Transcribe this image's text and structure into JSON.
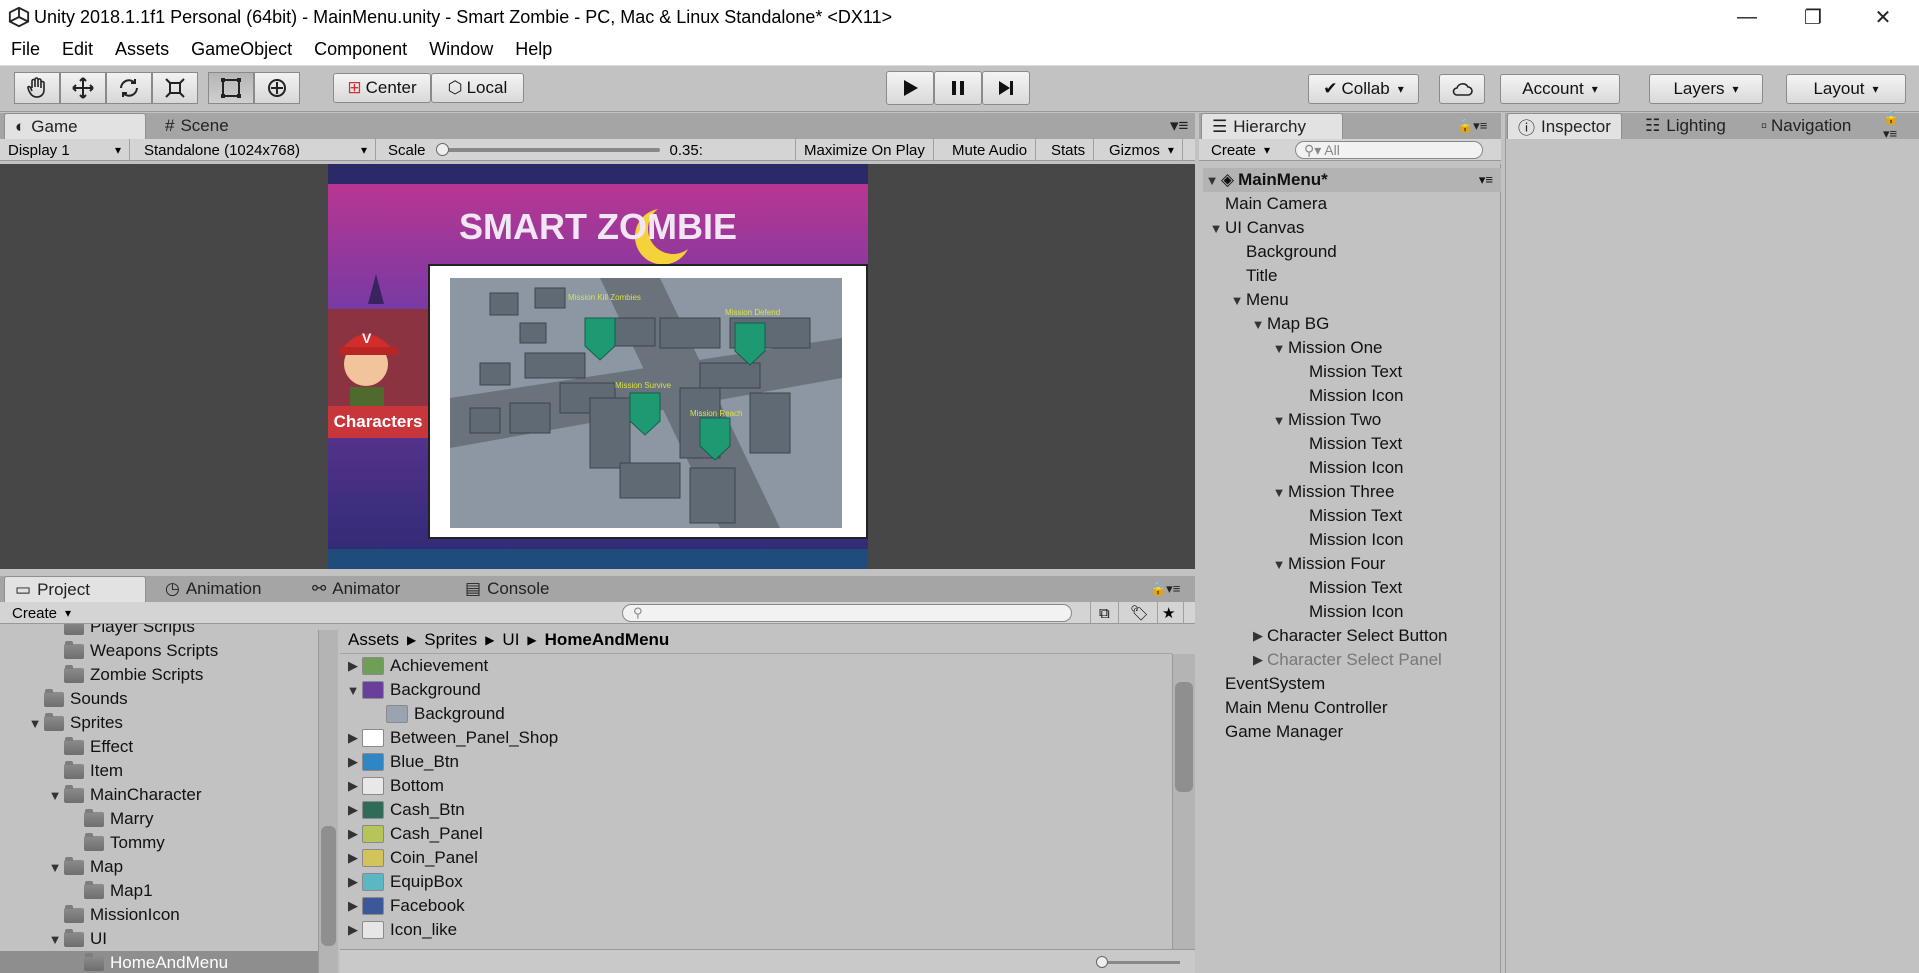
{
  "window": {
    "title": "Unity 2018.1.1f1 Personal (64bit) - MainMenu.unity - Smart Zombie - PC, Mac & Linux Standalone* <DX11>",
    "minimize": "—",
    "maximize": "❐",
    "close": "✕"
  },
  "menu": [
    "File",
    "Edit",
    "Assets",
    "GameObject",
    "Component",
    "Window",
    "Help"
  ],
  "toolbar": {
    "tools": [
      "hand-tool-icon",
      "move-tool-icon",
      "rotate-tool-icon",
      "scale-tool-icon",
      "rect-tool-icon",
      "transform-tool-icon"
    ],
    "pivot": "Center",
    "space": "Local",
    "collab": "Collab",
    "account": "Account",
    "layers": "Layers",
    "layout": "Layout"
  },
  "game_panel": {
    "tabs": [
      "Game",
      "Scene"
    ],
    "display": "Display 1",
    "resolution": "Standalone (1024x768)",
    "scale_label": "Scale",
    "scale_value": "0.35:",
    "scale_level": 0.0,
    "options": [
      "Maximize On Play",
      "Mute Audio",
      "Stats",
      "Gizmos"
    ]
  },
  "game_view": {
    "title": "SMART ZOMBIE",
    "characters_label": "Characters",
    "missions": [
      "Mission Kill Zombies",
      "Mission Defend",
      "Mission Survive",
      "Mission Reach"
    ]
  },
  "hierarchy": {
    "tab": "Hierarchy",
    "create": "Create",
    "search_placeholder": "All",
    "root": "MainMenu*",
    "items": [
      {
        "label": "Main Camera",
        "depth": 1,
        "arrow": ""
      },
      {
        "label": "UI Canvas",
        "depth": 1,
        "arrow": "▼"
      },
      {
        "label": "Background",
        "depth": 2,
        "arrow": ""
      },
      {
        "label": "Title",
        "depth": 2,
        "arrow": ""
      },
      {
        "label": "Menu",
        "depth": 2,
        "arrow": "▼"
      },
      {
        "label": "Map BG",
        "depth": 3,
        "arrow": "▼"
      },
      {
        "label": "Mission One",
        "depth": 4,
        "arrow": "▼"
      },
      {
        "label": "Mission Text",
        "depth": 5,
        "arrow": ""
      },
      {
        "label": "Mission Icon",
        "depth": 5,
        "arrow": ""
      },
      {
        "label": "Mission Two",
        "depth": 4,
        "arrow": "▼"
      },
      {
        "label": "Mission Text",
        "depth": 5,
        "arrow": ""
      },
      {
        "label": "Mission Icon",
        "depth": 5,
        "arrow": ""
      },
      {
        "label": "Mission Three",
        "depth": 4,
        "arrow": "▼"
      },
      {
        "label": "Mission Text",
        "depth": 5,
        "arrow": ""
      },
      {
        "label": "Mission Icon",
        "depth": 5,
        "arrow": ""
      },
      {
        "label": "Mission Four",
        "depth": 4,
        "arrow": "▼"
      },
      {
        "label": "Mission Text",
        "depth": 5,
        "arrow": ""
      },
      {
        "label": "Mission Icon",
        "depth": 5,
        "arrow": ""
      },
      {
        "label": "Character Select Button",
        "depth": 3,
        "arrow": "▶"
      },
      {
        "label": "Character Select Panel",
        "depth": 3,
        "arrow": "▶",
        "dim": true
      },
      {
        "label": "EventSystem",
        "depth": 1,
        "arrow": ""
      },
      {
        "label": "Main Menu Controller",
        "depth": 1,
        "arrow": ""
      },
      {
        "label": "Game Manager",
        "depth": 1,
        "arrow": ""
      }
    ]
  },
  "inspector": {
    "tabs": [
      "Inspector",
      "Lighting",
      "Navigation"
    ]
  },
  "project_panel": {
    "tabs": [
      "Project",
      "Animation",
      "Animator",
      "Console"
    ],
    "create": "Create",
    "folders": [
      {
        "label": "Player Scripts",
        "depth": 2,
        "arrow": ""
      },
      {
        "label": "Weapons Scripts",
        "depth": 2,
        "arrow": ""
      },
      {
        "label": "Zombie Scripts",
        "depth": 2,
        "arrow": ""
      },
      {
        "label": "Sounds",
        "depth": 1,
        "arrow": ""
      },
      {
        "label": "Sprites",
        "depth": 1,
        "arrow": "▼"
      },
      {
        "label": "Effect",
        "depth": 2,
        "arrow": ""
      },
      {
        "label": "Item",
        "depth": 2,
        "arrow": ""
      },
      {
        "label": "MainCharacter",
        "depth": 2,
        "arrow": "▼"
      },
      {
        "label": "Marry",
        "depth": 3,
        "arrow": ""
      },
      {
        "label": "Tommy",
        "depth": 3,
        "arrow": ""
      },
      {
        "label": "Map",
        "depth": 2,
        "arrow": "▼"
      },
      {
        "label": "Map1",
        "depth": 3,
        "arrow": ""
      },
      {
        "label": "MissionIcon",
        "depth": 2,
        "arrow": ""
      },
      {
        "label": "UI",
        "depth": 2,
        "arrow": "▼"
      },
      {
        "label": "HomeAndMenu",
        "depth": 3,
        "arrow": "",
        "selected": true
      }
    ],
    "breadcrumb": [
      "Assets",
      "Sprites",
      "UI",
      "HomeAndMenu"
    ],
    "assets": [
      {
        "label": "Achievement",
        "arrow": "▶",
        "color": "#6f9f57",
        "depth": 0
      },
      {
        "label": "Background",
        "arrow": "▼",
        "color": "#6a3f9c",
        "depth": 0
      },
      {
        "label": "Background",
        "arrow": "",
        "color": "#9aa4b0",
        "depth": 1
      },
      {
        "label": "Between_Panel_Shop",
        "arrow": "▶",
        "color": "#ffffff",
        "depth": 0
      },
      {
        "label": "Blue_Btn",
        "arrow": "▶",
        "color": "#2f86c4",
        "depth": 0
      },
      {
        "label": "Bottom",
        "arrow": "▶",
        "color": "#e8e8e8",
        "depth": 0
      },
      {
        "label": "Cash_Btn",
        "arrow": "▶",
        "color": "#2f6b57",
        "depth": 0
      },
      {
        "label": "Cash_Panel",
        "arrow": "▶",
        "color": "#b6c45a",
        "depth": 0
      },
      {
        "label": "Coin_Panel",
        "arrow": "▶",
        "color": "#d2c35a",
        "depth": 0
      },
      {
        "label": "EquipBox",
        "arrow": "▶",
        "color": "#5bb7c4",
        "depth": 0
      },
      {
        "label": "Facebook",
        "arrow": "▶",
        "color": "#3b5998",
        "depth": 0
      },
      {
        "label": "Icon_like",
        "arrow": "▶",
        "color": "#e6e6e6",
        "depth": 0
      }
    ]
  }
}
